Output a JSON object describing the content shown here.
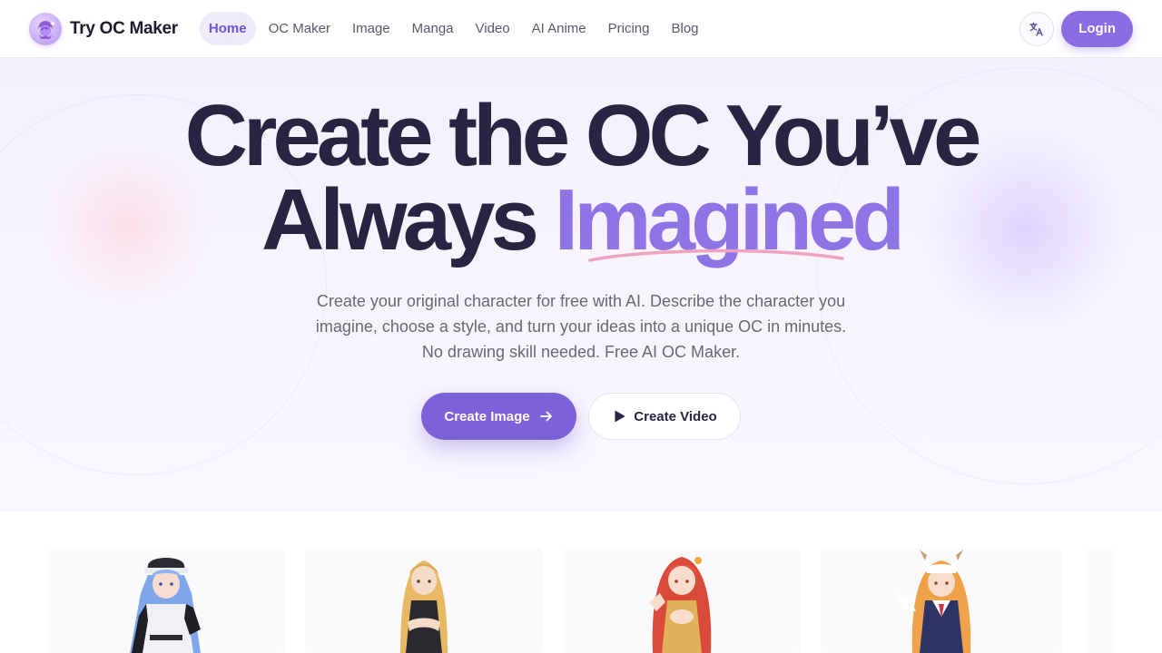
{
  "brand": {
    "name": "Try OC Maker",
    "logo_icon": "character-logo-icon"
  },
  "nav": {
    "links": [
      {
        "label": "Home",
        "active": true
      },
      {
        "label": "OC Maker",
        "active": false
      },
      {
        "label": "Image",
        "active": false
      },
      {
        "label": "Manga",
        "active": false
      },
      {
        "label": "Video",
        "active": false
      },
      {
        "label": "AI Anime",
        "active": false
      },
      {
        "label": "Pricing",
        "active": false
      },
      {
        "label": "Blog",
        "active": false
      }
    ],
    "language_icon": "translate-icon",
    "login_label": "Login"
  },
  "hero": {
    "headline_line1": "Create the OC You’ve",
    "headline_line2_prefix": "Always ",
    "headline_accent": "Imagined",
    "subtext_lines": [
      "Create your original character for free with AI. Describe the character you",
      "imagine, choose a style, and turn your ideas into a unique OC in minutes.",
      "No drawing skill needed. Free AI OC Maker."
    ],
    "primary_cta": "Create Image",
    "secondary_cta": "Create Video"
  },
  "gallery": {
    "items": [
      {
        "character": "anime-officer-blue-hair"
      },
      {
        "character": "anime-blonde-arms-crossed"
      },
      {
        "character": "anime-red-hair-girl"
      },
      {
        "character": "anime-dragon-maid"
      }
    ]
  },
  "colors": {
    "accent": "#8b6ce3",
    "primary_button": "#7d61d9",
    "headline": "#2a2342",
    "accent_text": "#8f74e6",
    "underline": "#f0a3bf",
    "hero_bg": "#f5f1fd"
  }
}
